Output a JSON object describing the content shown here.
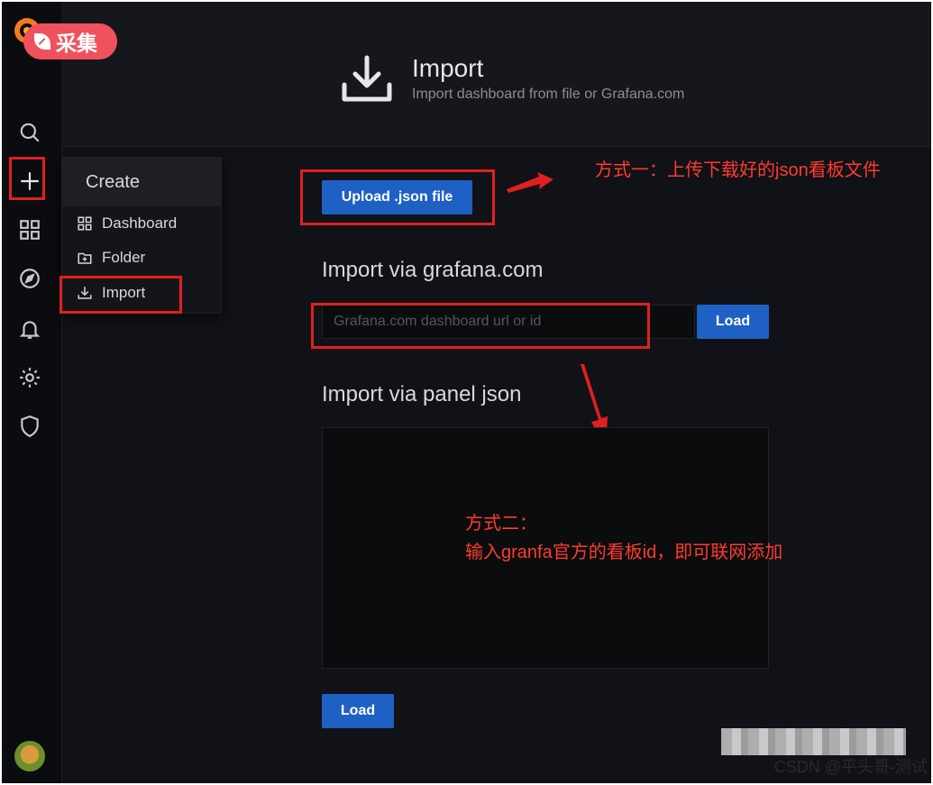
{
  "badge": {
    "label": "采集"
  },
  "header": {
    "title": "Import",
    "subtitle": "Import dashboard from file or Grafana.com"
  },
  "create_menu": {
    "title": "Create",
    "items": [
      {
        "label": "Dashboard",
        "icon": "dashboard-icon"
      },
      {
        "label": "Folder",
        "icon": "folder-icon"
      },
      {
        "label": "Import",
        "icon": "import-icon"
      }
    ]
  },
  "sidebar": {
    "icons": [
      "grafana-logo",
      "search-icon",
      "plus-icon",
      "dashboards-icon",
      "explore-icon",
      "alerting-icon",
      "configuration-icon",
      "shield-icon",
      "avatar"
    ]
  },
  "upload": {
    "button_label": "Upload .json file"
  },
  "grafana_com": {
    "title": "Import via grafana.com",
    "input_placeholder": "Grafana.com dashboard url or id",
    "load_label": "Load"
  },
  "panel_json": {
    "title": "Import via panel json",
    "load_label": "Load"
  },
  "annotations": {
    "method_one": "方式一：上传下载好的json看板文件",
    "method_two_line1": "方式二：",
    "method_two_line2": "输入granfa官方的看板id，即可联网添加"
  },
  "watermark": "CSDN @平头哥-测试",
  "colors": {
    "background": "#111217",
    "sidebar": "#0b0c0f",
    "primary_button": "#1f60c4",
    "annotation_red": "#ff3b2f",
    "badge": "#f0525d"
  }
}
